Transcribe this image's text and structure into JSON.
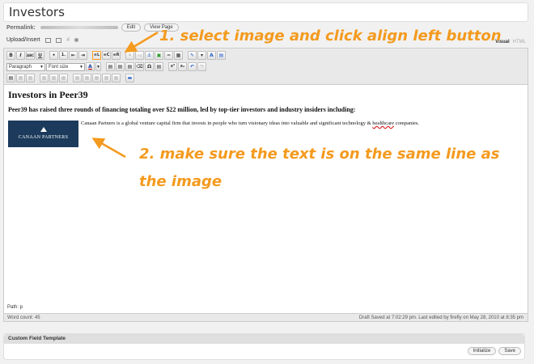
{
  "post": {
    "title": "Investors",
    "permalink_label": "Permalink:",
    "edit_label": "Edit",
    "view_page_label": "View Page"
  },
  "upload": {
    "label": "Upload/Insert",
    "icons": [
      "image-icon",
      "video-icon",
      "audio-icon",
      "media-icon"
    ]
  },
  "mode_tabs": {
    "visual": "Visual",
    "html": "HTML"
  },
  "toolbar": {
    "row1": [
      "B",
      "I",
      "ABC",
      "U",
      "•",
      "1.",
      "⇤",
      "⇥",
      "≡L",
      "≡C",
      "≡R",
      "⚭",
      "⚭x",
      "⚓",
      "▣",
      "━",
      "▦",
      "✎",
      "▾",
      "A",
      "▤"
    ],
    "row2_format": "Paragraph",
    "row2_font_size": "Font size",
    "row2_buttons": [
      "A",
      "▾",
      "▤",
      "▤",
      "▤",
      "⌫",
      "Ω",
      "▤",
      "x²",
      "x₂",
      "↶",
      "↷"
    ],
    "row3": [
      "▤",
      "▦",
      "▦",
      "▦",
      "▦",
      "▦",
      "▦",
      "▦",
      "▦",
      "▦",
      "▦",
      "▬"
    ]
  },
  "content": {
    "heading": "Investors in Peer39",
    "lead": "Peer39 has raised three rounds of financing totaling over $22 million, led by top-tier investors and industry insiders including:",
    "logo_text": "CANAAN PARTNERS",
    "paragraph_before": "Canaan Partners is a global venture capital firm that invests in people who turn visionary ideas into valuable and significant technology & ",
    "paragraph_spell": "healthcare",
    "paragraph_after": " companies."
  },
  "annotations": {
    "step1": "1. select image and click align left button",
    "step2_line1": "2. make sure the text is on the same line as",
    "step2_line2": "the image",
    "color": "#f49a1e"
  },
  "status": {
    "path": "Path: p",
    "word_count": "Word count: 45",
    "draft": "Draft Saved at 7:02:29 pm. Last edited by firefly on May 28, 2010 at 8:35 pm"
  },
  "custom_field": {
    "title": "Custom Field Template",
    "initialize_label": "Initialize",
    "save_label": "Save"
  }
}
